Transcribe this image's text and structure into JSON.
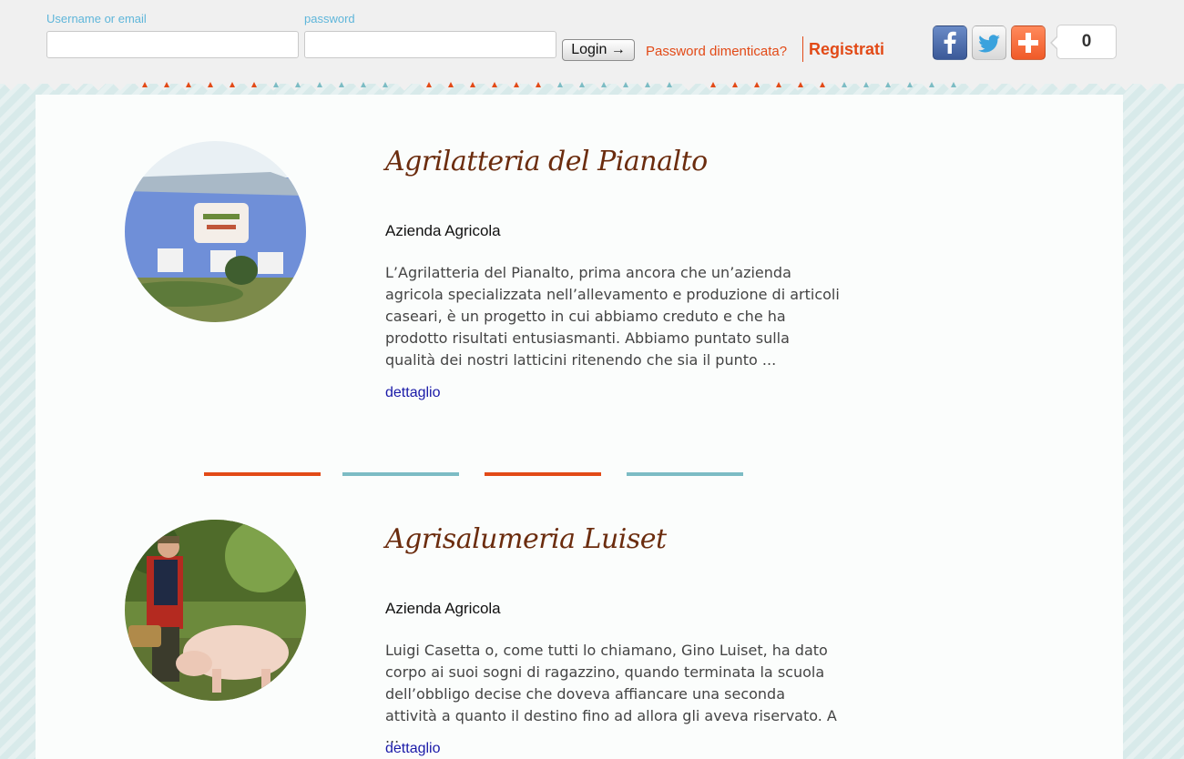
{
  "login": {
    "username_label": "Username or email",
    "username_value": "",
    "password_label": "password",
    "password_value": "",
    "login_button": "Login →",
    "forgot_password": "Password dimenticata?",
    "register": "Registrati"
  },
  "social": {
    "share_count": "0",
    "icons": [
      "facebook-icon",
      "twitter-icon",
      "plus-share-icon"
    ]
  },
  "colors": {
    "accent_orange": "#e24a17",
    "accent_teal": "#7cbcc4",
    "title_brown": "#6b2c0e",
    "label_blue": "#5fb6da"
  },
  "entries": [
    {
      "title": "Agrilatteria del Pianalto",
      "type": "Azienda Agricola",
      "description": "L’Agrilatteria del Pianalto, prima ancora che un’azienda agricola specializzata nell’allevamento e produzione di articoli caseari, è un progetto in cui abbiamo creduto e che ha prodotto risultati entusiasmanti. Abbiamo puntato sulla qualità dei nostri latticini ritenendo che sia il punto ...",
      "link": "dettaglio"
    },
    {
      "title": "Agrisalumeria Luiset",
      "type": "Azienda Agricola",
      "description": "Luigi Casetta o, come tutti lo chiamano, Gino Luiset, ha dato corpo ai suoi sogni di ragazzino, quando terminata la scuola dell’obbligo decise che doveva affiancare una seconda attività a quanto il destino fino ad allora gli aveva riservato. A ...",
      "link": "dettaglio"
    }
  ]
}
